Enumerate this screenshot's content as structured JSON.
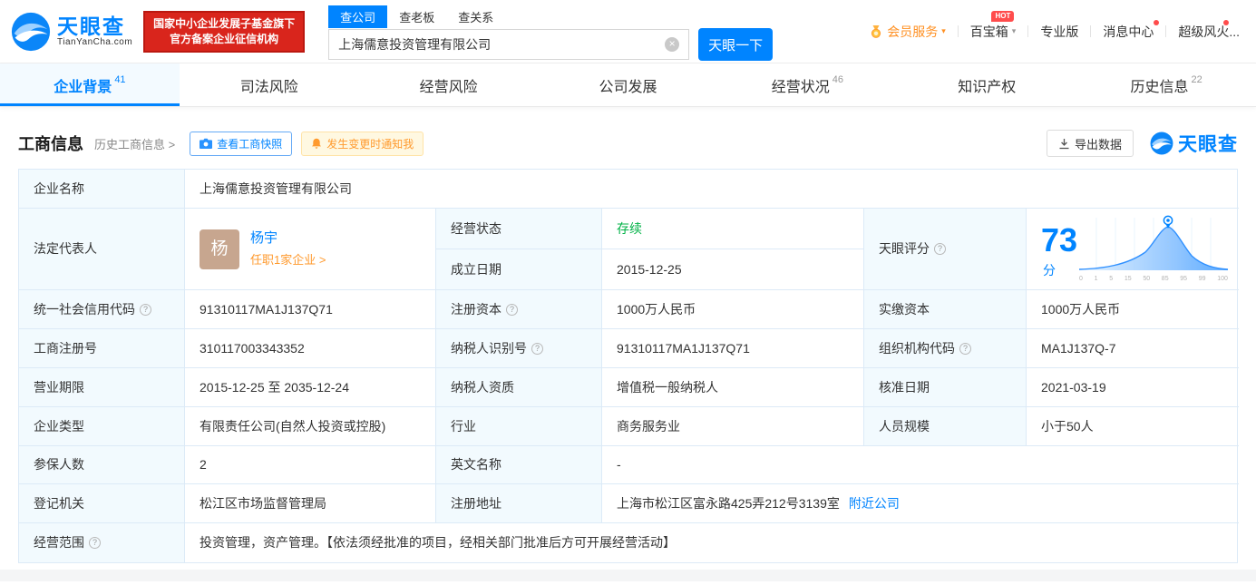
{
  "header": {
    "logo_cn": "天眼查",
    "logo_en": "TianYanCha.com",
    "badge_line1": "国家中小企业发展子基金旗下",
    "badge_line2": "官方备案企业征信机构",
    "search_tabs": [
      "查公司",
      "查老板",
      "查关系"
    ],
    "search_value": "上海儒意投资管理有限公司",
    "search_button": "天眼一下",
    "menu": [
      {
        "label": "会员服务"
      },
      {
        "label": "百宝箱",
        "badge": "HOT"
      },
      {
        "label": "专业版"
      },
      {
        "label": "消息中心"
      },
      {
        "label": "超级风火..."
      }
    ]
  },
  "nav": {
    "tabs": [
      {
        "label": "企业背景",
        "count": "41"
      },
      {
        "label": "司法风险"
      },
      {
        "label": "经营风险"
      },
      {
        "label": "公司发展"
      },
      {
        "label": "经营状况",
        "count": "46"
      },
      {
        "label": "知识产权"
      },
      {
        "label": "历史信息",
        "count": "22"
      }
    ]
  },
  "section": {
    "title": "工商信息",
    "history_link": "历史工商信息 >",
    "snapshot_button": "查看工商快照",
    "notify_button": "发生变更时通知我",
    "export_button": "导出数据",
    "watermark": "天眼查"
  },
  "score": {
    "value": "73",
    "unit": "分",
    "axis": [
      "0",
      "1",
      "5",
      "15",
      "50",
      "85",
      "95",
      "99",
      "100"
    ]
  },
  "table": {
    "company_name": {
      "label": "企业名称",
      "value": "上海儒意投资管理有限公司"
    },
    "legal_rep": {
      "label": "法定代表人",
      "avatar": "杨",
      "name": "杨宇",
      "link": "任职1家企业 >"
    },
    "status": {
      "label": "经营状态",
      "value": "存续"
    },
    "est_date": {
      "label": "成立日期",
      "value": "2015-12-25"
    },
    "score_label": "天眼评分",
    "credit_code": {
      "label": "统一社会信用代码",
      "value": "91310117MA1J137Q71"
    },
    "reg_capital": {
      "label": "注册资本",
      "value": "1000万人民币"
    },
    "paid_capital": {
      "label": "实缴资本",
      "value": "1000万人民币"
    },
    "reg_number": {
      "label": "工商注册号",
      "value": "310117003343352"
    },
    "taxpayer_id": {
      "label": "纳税人识别号",
      "value": "91310117MA1J137Q71"
    },
    "org_code": {
      "label": "组织机构代码",
      "value": "MA1J137Q-7"
    },
    "business_term": {
      "label": "营业期限",
      "value": "2015-12-25 至 2035-12-24"
    },
    "taxpayer_quality": {
      "label": "纳税人资质",
      "value": "增值税一般纳税人"
    },
    "approval_date": {
      "label": "核准日期",
      "value": "2021-03-19"
    },
    "company_type": {
      "label": "企业类型",
      "value": "有限责任公司(自然人投资或控股)"
    },
    "industry": {
      "label": "行业",
      "value": "商务服务业"
    },
    "staff_size": {
      "label": "人员规模",
      "value": "小于50人"
    },
    "insured_count": {
      "label": "参保人数",
      "value": "2"
    },
    "english_name": {
      "label": "英文名称",
      "value": "-"
    },
    "reg_authority": {
      "label": "登记机关",
      "value": "松江区市场监督管理局"
    },
    "reg_address": {
      "label": "注册地址",
      "value": "上海市松江区富永路425弄212号3139室",
      "link": "附近公司"
    },
    "business_scope": {
      "label": "经营范围",
      "value": "投资管理，资产管理。【依法须经批准的项目，经相关部门批准后方可开展经营活动】"
    }
  },
  "icons": {
    "info": "?",
    "clear": "×",
    "caret": "▾"
  }
}
